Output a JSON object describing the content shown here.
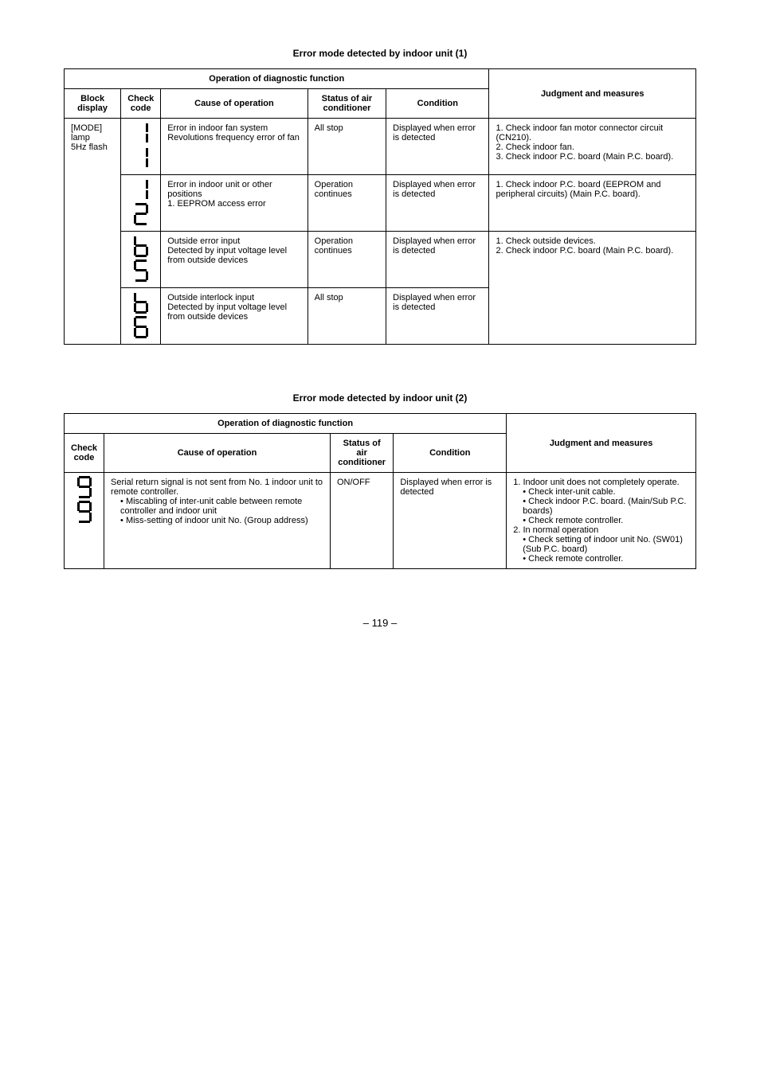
{
  "section1": {
    "title": "Error mode detected by indoor unit (1)",
    "merged_header": "Operation of diagnostic function",
    "headers": {
      "block_display": "Block\ndisplay",
      "check_code": "Check\ncode",
      "cause": "Cause of operation",
      "status": "Status of air\nconditioner",
      "condition": "Condition",
      "judgment": "Judgment and measures"
    },
    "block_display_value": "[MODE] lamp\n5Hz flash",
    "rows": [
      {
        "code": "11",
        "cause": "Error in indoor fan system\nRevolutions frequency error of fan",
        "status": "All stop",
        "condition": "Displayed when error is detected",
        "judgment": "1. Check indoor fan motor connector circuit (CN210).\n2. Check indoor fan.\n3. Check indoor P.C. board (Main P.C. board)."
      },
      {
        "code": "12",
        "cause": "Error in indoor unit or other positions\n1. EEPROM access error",
        "status": "Operation continues",
        "condition": "Displayed when error is detected",
        "judgment": "1. Check indoor P.C. board (EEPROM and peripheral circuits) (Main P.C. board)."
      },
      {
        "code": "b5",
        "cause": "Outside error input\nDetected by input voltage level from outside devices",
        "status": "Operation continues",
        "condition": "Displayed when error is detected",
        "judgment": "1. Check outside devices.\n2. Check indoor P.C. board (Main P.C. board)."
      },
      {
        "code": "b6",
        "cause": "Outside interlock input\nDetected by input voltage level from outside devices",
        "status": "All stop",
        "condition": "Displayed when error is detected",
        "judgment": ""
      }
    ]
  },
  "section2": {
    "title": "Error mode detected by indoor unit (2)",
    "merged_header": "Operation of diagnostic function",
    "headers": {
      "check_code": "Check\ncode",
      "cause": "Cause of operation",
      "status": "Status of air\nconditioner",
      "condition": "Condition",
      "judgment": "Judgment and measures"
    },
    "rows": [
      {
        "code": "99",
        "cause_main": "Serial return signal is not sent from No. 1 indoor unit to remote controller.",
        "cause_bullets": [
          "Miscabling of inter-unit cable between remote controller and indoor unit",
          "Miss-setting of indoor unit No. (Group address)"
        ],
        "status": "ON/OFF",
        "condition": "Displayed when error is detected",
        "judgment_1": "1. Indoor unit does not completely operate.",
        "judgment_1_bullets": [
          "Check inter-unit cable.",
          "Check indoor P.C. board. (Main/Sub P.C. boards)",
          "Check remote controller."
        ],
        "judgment_2": "2. In normal operation",
        "judgment_2_bullets": [
          "Check setting of indoor unit No. (SW01) (Sub P.C. board)",
          "Check remote controller."
        ]
      }
    ]
  },
  "page_number": "– 119 –"
}
